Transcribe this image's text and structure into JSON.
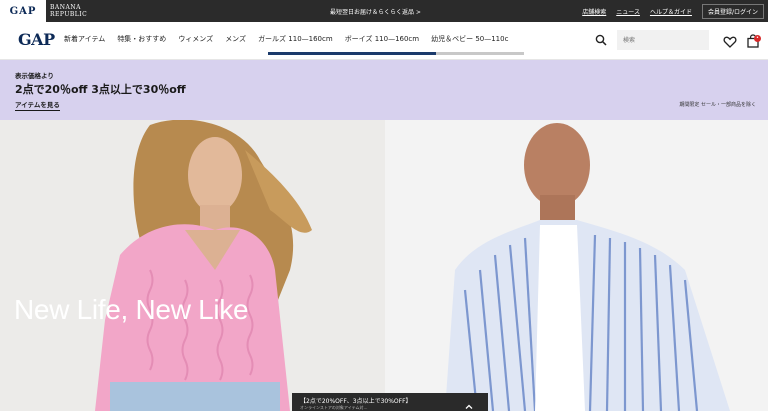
{
  "topbar": {
    "brand_gap": "GAP",
    "brand_br_line1": "BANANA",
    "brand_br_line2": "REPUBLIC",
    "promo": "最短翌日お届け＆らくらく返品 >",
    "links": [
      "店舗検索",
      "ニュース",
      "ヘルプ＆ガイド"
    ],
    "login": "会員登録/ログイン"
  },
  "nav": {
    "logo": "GAP",
    "items": [
      "新着アイテム",
      "特集・おすすめ",
      "ウィメンズ",
      "メンズ",
      "ガールズ 110—160cm",
      "ボーイズ 110—160cm",
      "幼児＆ベビー 50—110c"
    ],
    "search_placeholder": "検索",
    "icons": [
      "search-icon",
      "heart-icon",
      "bag-icon"
    ],
    "colors": {
      "logo": "#0d2a57",
      "active_underline": "#1b3a6b",
      "badge": "#d72a2a"
    }
  },
  "promo_banner": {
    "eyebrow": "表示価格より",
    "headline": "2点で20％off 3点以上で30％off",
    "cta": "アイテムを見る",
    "note": "期間限定 セール・一部商品を除く",
    "background": "#d7d1ee"
  },
  "hero": {
    "headline": "New Life, New Like"
  },
  "sticky_bar": {
    "title": "【2点で20%OFF、3点以上で30%OFF】",
    "subtitle": "オンラインストアの対象アイテム対…"
  }
}
